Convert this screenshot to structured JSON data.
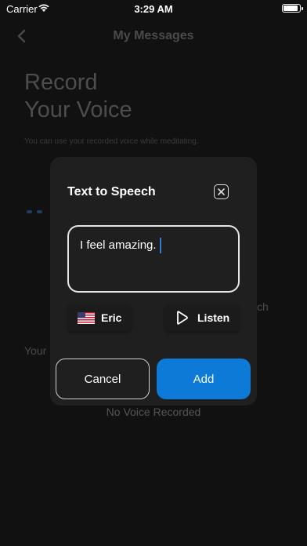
{
  "status_bar": {
    "carrier": "Carrier",
    "time": "3:29 AM"
  },
  "background": {
    "nav_title": "My Messages",
    "title_line1": "Record",
    "title_line2": "Your Voice",
    "subtitle": "You can use your recorded voice while meditating.",
    "side_partial": "ch",
    "your_partial": "Your",
    "no_voice": "No Voice Recorded"
  },
  "modal": {
    "title": "Text to Speech",
    "text_value": "I feel amazing.",
    "voice_label": "Eric",
    "listen_label": "Listen",
    "cancel_label": "Cancel",
    "add_label": "Add"
  },
  "colors": {
    "accent": "#0c7ad6",
    "modal_bg": "#1f1f1f",
    "page_bg": "#111111"
  },
  "icons": [
    "wifi-icon",
    "battery-icon",
    "back-arrow-icon",
    "close-icon",
    "us-flag-icon",
    "play-icon"
  ]
}
